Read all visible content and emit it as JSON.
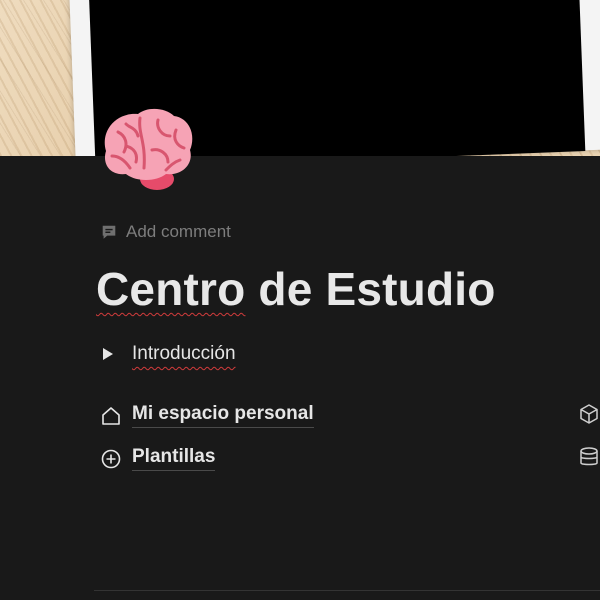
{
  "page": {
    "icon": "brain-emoji-icon",
    "comment_label": "Add comment",
    "title_part1": "Centro",
    "title_part2": " de Estudio"
  },
  "toggle": {
    "label": "Introducción",
    "icon": "triangle-right-icon"
  },
  "links": [
    {
      "label": "Mi espacio personal",
      "icon": "house-icon"
    },
    {
      "label": "Plantillas",
      "icon": "circle-plus-icon"
    }
  ],
  "right_column": [
    {
      "icon": "cube-icon"
    },
    {
      "icon": "database-icon"
    }
  ],
  "colors": {
    "background": "#191919",
    "text": "#e6e6e6",
    "muted": "#7d7d7d",
    "spellcheck": "#d23b3b"
  }
}
